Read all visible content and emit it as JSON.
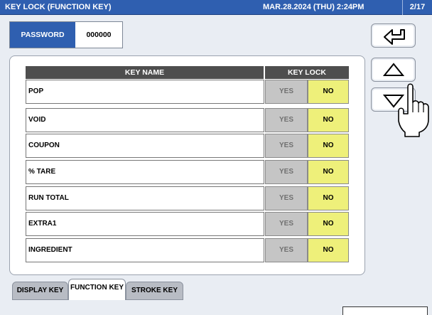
{
  "titlebar": {
    "title": "KEY LOCK (FUNCTION KEY)",
    "datetime": "MAR.28.2024 (THU)  2:24PM",
    "page": "2/17"
  },
  "password": {
    "label": "PASSWORD",
    "value": "000000"
  },
  "table": {
    "col_keyname": "KEY NAME",
    "col_keylock": "KEY LOCK",
    "rows": [
      {
        "name": "POP",
        "yes": "YES",
        "no": "NO"
      },
      {
        "name": "VOID",
        "yes": "YES",
        "no": "NO"
      },
      {
        "name": "COUPON",
        "yes": "YES",
        "no": "NO"
      },
      {
        "name": "% TARE",
        "yes": "YES",
        "no": "NO"
      },
      {
        "name": "RUN TOTAL",
        "yes": "YES",
        "no": "NO"
      },
      {
        "name": "EXTRA1",
        "yes": "YES",
        "no": "NO"
      },
      {
        "name": "INGREDIENT",
        "yes": "YES",
        "no": "NO"
      }
    ]
  },
  "tabs": [
    {
      "label": "DISPLAY KEY",
      "active": false
    },
    {
      "label": "FUNCTION KEY",
      "active": true
    },
    {
      "label": "STROKE KEY",
      "active": false
    }
  ],
  "side_buttons": {
    "back_icon": "return-arrow-icon",
    "up_icon": "up-triangle-icon",
    "down_icon": "down-triangle-icon"
  },
  "colors": {
    "titlebar": "#2f5fb0",
    "header": "#4e4e4e",
    "yes_bg": "#c5c5c5",
    "no_bg": "#eef07a",
    "screen_bg": "#e9edf3"
  }
}
